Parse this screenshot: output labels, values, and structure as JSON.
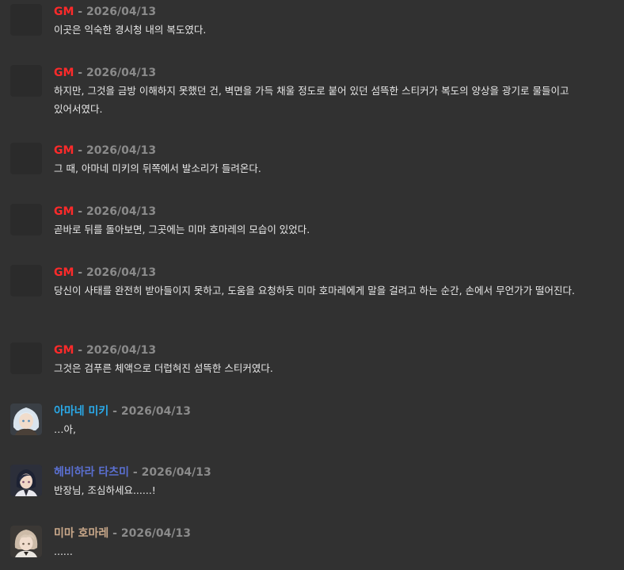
{
  "messages": [
    {
      "speaker": "GM",
      "separator": " - ",
      "date": "2026/04/13",
      "text": "이곳은 익숙한 경시청 내의 복도였다.",
      "speaker_color": "#ff2a2a"
    },
    {
      "speaker": "GM",
      "separator": " - ",
      "date": "2026/04/13",
      "text": "하지만, 그것을 금방 이해하지 못했던 건, 벽면을 가득 채울 정도로 붙어 있던 섬뜩한 스티커가 복도의 양상을 광기로 물들이고 있어서였다.",
      "speaker_color": "#ff2a2a"
    },
    {
      "speaker": "GM",
      "separator": " - ",
      "date": "2026/04/13",
      "text": "그 때, 아마네 미키의 뒤쪽에서 발소리가 들려온다.",
      "speaker_color": "#ff2a2a"
    },
    {
      "speaker": "GM",
      "separator": " - ",
      "date": "2026/04/13",
      "text": "곧바로 뒤를 돌아보면, 그곳에는 미마 호마레의 모습이 있었다.",
      "speaker_color": "#ff2a2a"
    },
    {
      "speaker": "GM",
      "separator": " - ",
      "date": "2026/04/13",
      "text": "당신이 사태를 완전히 받아들이지 못하고, 도움을 요청하듯 미마 호마레에게 말을 걸려고 하는 순간, 손에서 무언가가 떨어진다.",
      "speaker_color": "#ff2a2a"
    },
    {
      "speaker": "GM",
      "separator": " - ",
      "date": "2026/04/13",
      "text": "그것은 검푸른 체액으로 더럽혀진 섬뜩한 스티커였다.",
      "speaker_color": "#ff2a2a"
    },
    {
      "speaker": "아마네 미키",
      "separator": " - ",
      "date": "2026/04/13",
      "text": "…아,",
      "speaker_color": "#2aa9e8"
    },
    {
      "speaker": "헤비하라 타츠미",
      "separator": " - ",
      "date": "2026/04/13",
      "text": "반장님, 조심하세요......!",
      "speaker_color": "#5a6fd0"
    },
    {
      "speaker": "미마 호마레",
      "separator": " - ",
      "date": "2026/04/13",
      "text": "......",
      "speaker_color": "#c9a88a"
    }
  ],
  "icons": {
    "gm_avatar": "blank-avatar-icon",
    "amane_avatar": "character-portrait-icon",
    "hebihara_avatar": "character-portrait-icon",
    "mima_avatar": "character-portrait-icon"
  }
}
